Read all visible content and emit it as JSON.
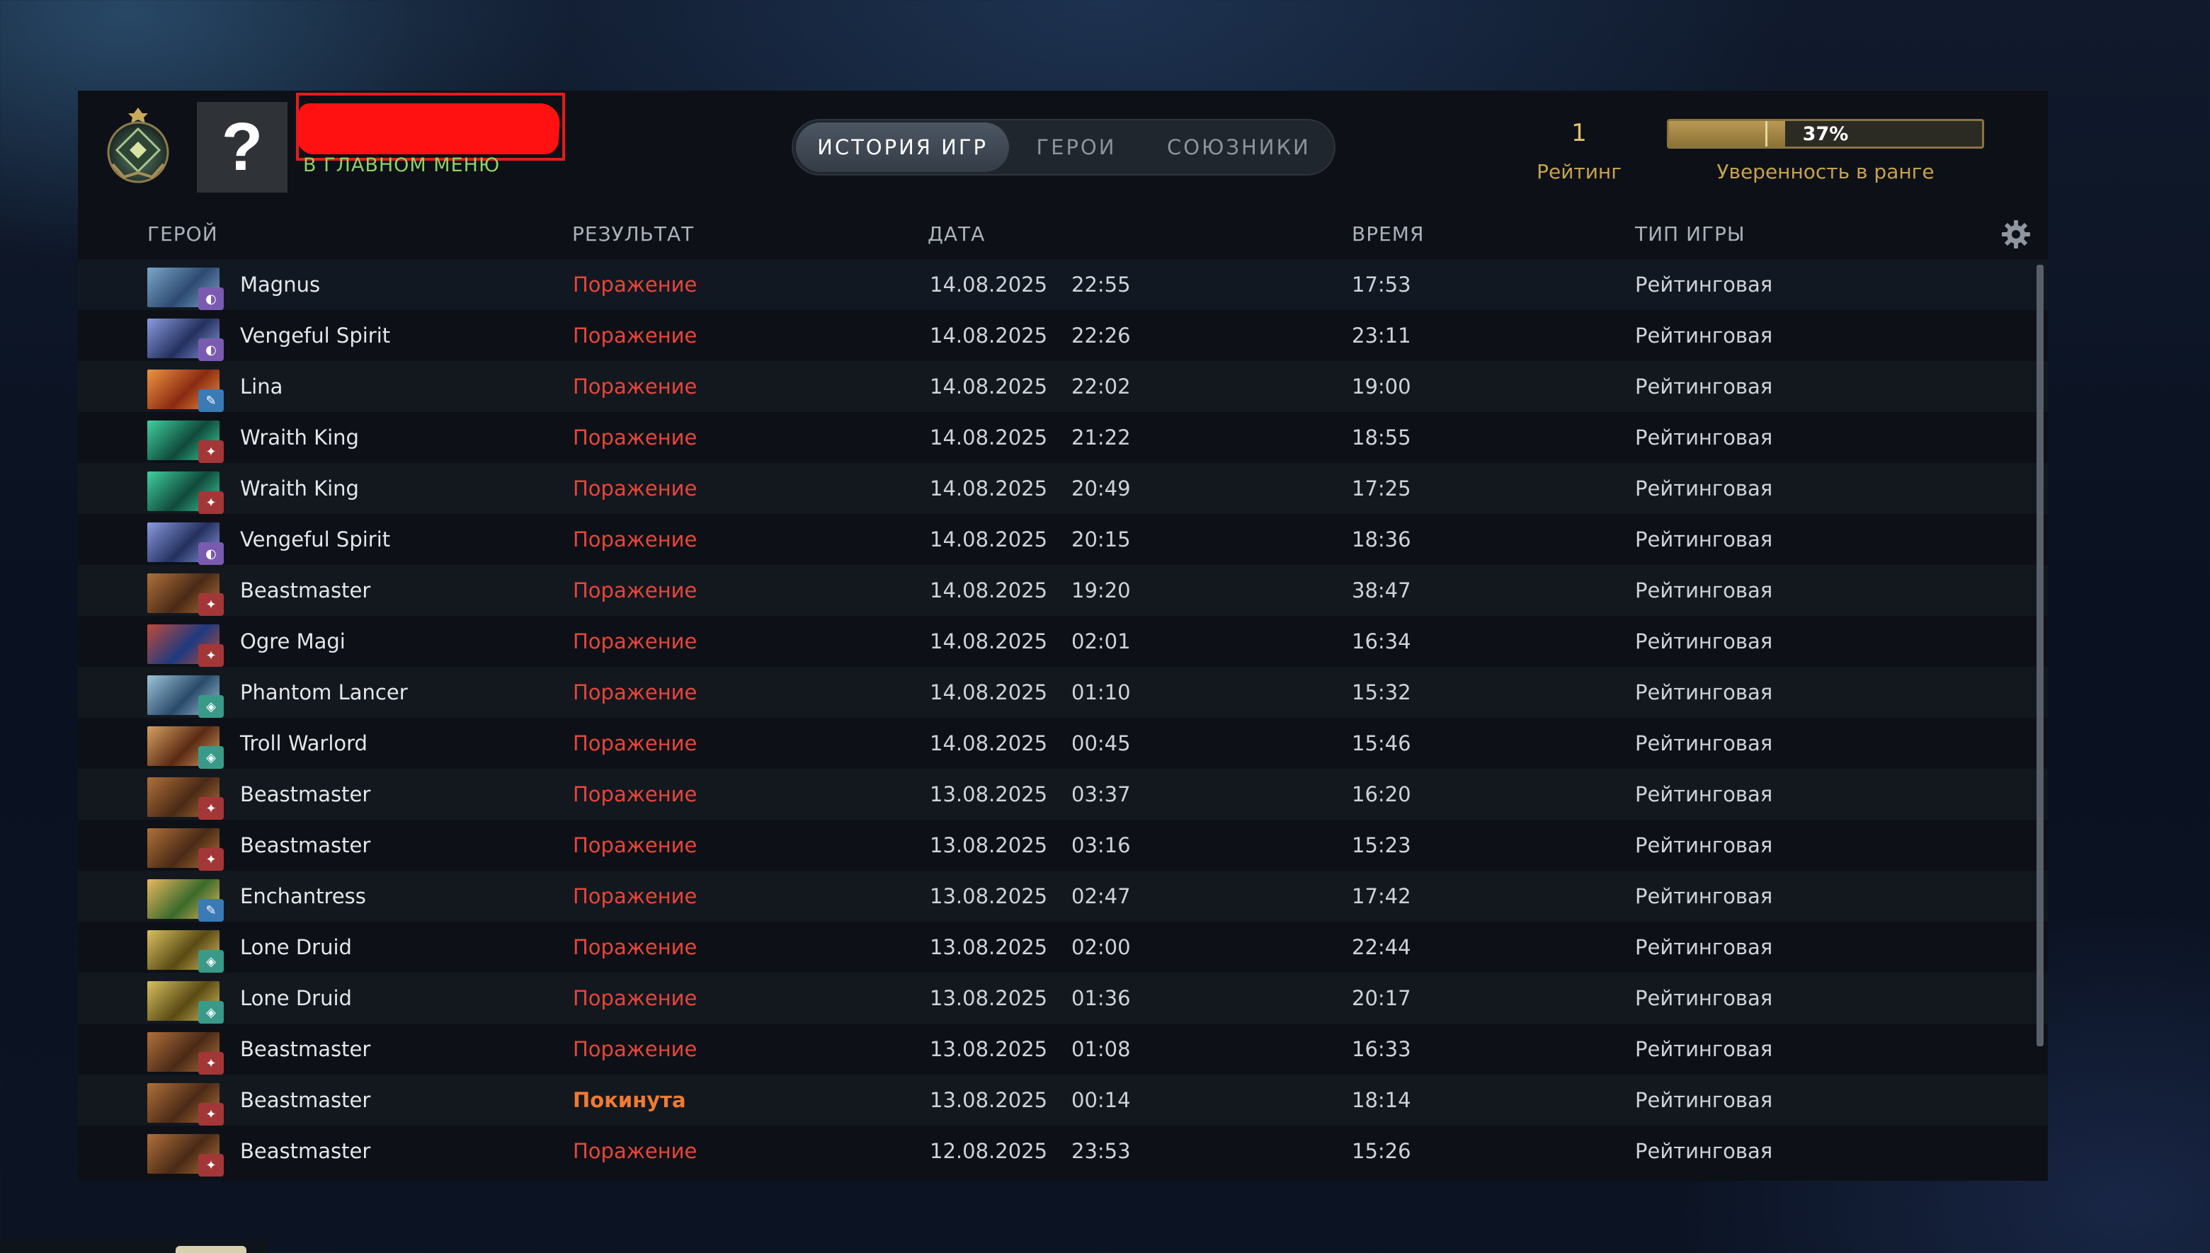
{
  "header": {
    "player_name_redacted": "",
    "avatar_placeholder": "?",
    "status": "В ГЛАВНОМ МЕНЮ",
    "tabs": [
      {
        "label": "ИСТОРИЯ ИГР",
        "active": true
      },
      {
        "label": "ГЕРОИ",
        "active": false
      },
      {
        "label": "СОЮЗНИКИ",
        "active": false
      }
    ],
    "rating_value": "1",
    "rating_label": "Рейтинг",
    "confidence_value": "37%",
    "confidence_fraction": 0.37,
    "confidence_label": "Уверенность в ранге"
  },
  "columns": {
    "hero": "ГЕРОЙ",
    "result": "РЕЗУЛЬТАТ",
    "date": "ДАТА",
    "duration": "ВРЕМЯ",
    "game_type": "ТИП ИГРЫ"
  },
  "colors": {
    "loss": "#e8453a",
    "abandoned": "#f07a32",
    "status": "#8fd065",
    "accent_gold": "#c7a24f"
  },
  "matches": [
    {
      "hero": "Magnus",
      "result": "Поражение",
      "date": "14.08.2025",
      "time": "22:55",
      "duration": "17:53",
      "type": "Рейтинговая",
      "attr": "universal"
    },
    {
      "hero": "Vengeful Spirit",
      "result": "Поражение",
      "date": "14.08.2025",
      "time": "22:26",
      "duration": "23:11",
      "type": "Рейтинговая",
      "attr": "universal"
    },
    {
      "hero": "Lina",
      "result": "Поражение",
      "date": "14.08.2025",
      "time": "22:02",
      "duration": "19:00",
      "type": "Рейтинговая",
      "attr": "intelligence"
    },
    {
      "hero": "Wraith King",
      "result": "Поражение",
      "date": "14.08.2025",
      "time": "21:22",
      "duration": "18:55",
      "type": "Рейтинговая",
      "attr": "strength"
    },
    {
      "hero": "Wraith King",
      "result": "Поражение",
      "date": "14.08.2025",
      "time": "20:49",
      "duration": "17:25",
      "type": "Рейтинговая",
      "attr": "strength"
    },
    {
      "hero": "Vengeful Spirit",
      "result": "Поражение",
      "date": "14.08.2025",
      "time": "20:15",
      "duration": "18:36",
      "type": "Рейтинговая",
      "attr": "universal"
    },
    {
      "hero": "Beastmaster",
      "result": "Поражение",
      "date": "14.08.2025",
      "time": "19:20",
      "duration": "38:47",
      "type": "Рейтинговая",
      "attr": "strength"
    },
    {
      "hero": "Ogre Magi",
      "result": "Поражение",
      "date": "14.08.2025",
      "time": "02:01",
      "duration": "16:34",
      "type": "Рейтинговая",
      "attr": "strength"
    },
    {
      "hero": "Phantom Lancer",
      "result": "Поражение",
      "date": "14.08.2025",
      "time": "01:10",
      "duration": "15:32",
      "type": "Рейтинговая",
      "attr": "agility"
    },
    {
      "hero": "Troll Warlord",
      "result": "Поражение",
      "date": "14.08.2025",
      "time": "00:45",
      "duration": "15:46",
      "type": "Рейтинговая",
      "attr": "agility"
    },
    {
      "hero": "Beastmaster",
      "result": "Поражение",
      "date": "13.08.2025",
      "time": "03:37",
      "duration": "16:20",
      "type": "Рейтинговая",
      "attr": "strength"
    },
    {
      "hero": "Beastmaster",
      "result": "Поражение",
      "date": "13.08.2025",
      "time": "03:16",
      "duration": "15:23",
      "type": "Рейтинговая",
      "attr": "strength"
    },
    {
      "hero": "Enchantress",
      "result": "Поражение",
      "date": "13.08.2025",
      "time": "02:47",
      "duration": "17:42",
      "type": "Рейтинговая",
      "attr": "intelligence"
    },
    {
      "hero": "Lone Druid",
      "result": "Поражение",
      "date": "13.08.2025",
      "time": "02:00",
      "duration": "22:44",
      "type": "Рейтинговая",
      "attr": "agility"
    },
    {
      "hero": "Lone Druid",
      "result": "Поражение",
      "date": "13.08.2025",
      "time": "01:36",
      "duration": "20:17",
      "type": "Рейтинговая",
      "attr": "agility"
    },
    {
      "hero": "Beastmaster",
      "result": "Поражение",
      "date": "13.08.2025",
      "time": "01:08",
      "duration": "16:33",
      "type": "Рейтинговая",
      "attr": "strength"
    },
    {
      "hero": "Beastmaster",
      "result": "Покинута",
      "date": "13.08.2025",
      "time": "00:14",
      "duration": "18:14",
      "type": "Рейтинговая",
      "attr": "strength"
    },
    {
      "hero": "Beastmaster",
      "result": "Поражение",
      "date": "12.08.2025",
      "time": "23:53",
      "duration": "15:26",
      "type": "Рейтинговая",
      "attr": "strength"
    }
  ],
  "icons": {
    "rank": "rank-medal-icon",
    "settings": "gear-icon"
  }
}
